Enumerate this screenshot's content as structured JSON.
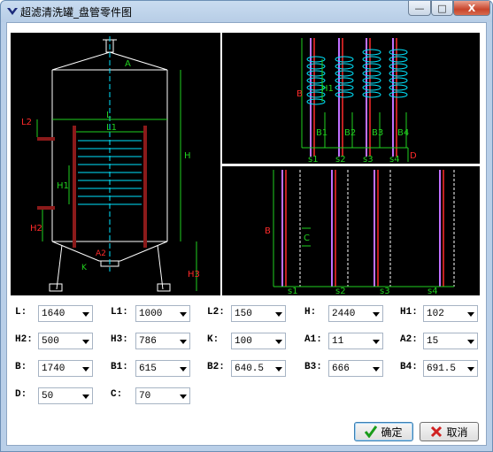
{
  "window": {
    "title": "超滤清洗罐_盘管零件图",
    "controls": {
      "minimize": "—",
      "maximize": "□",
      "close": "X"
    }
  },
  "drawing_left": {
    "dims": [
      "A",
      "L",
      "L1",
      "L2",
      "H",
      "H1",
      "H2",
      "H3",
      "K",
      "A2"
    ]
  },
  "drawing_top_right": {
    "dims": [
      "B",
      "H1",
      "B1",
      "B2",
      "B3",
      "B4",
      "D"
    ],
    "labels": [
      "s1",
      "s2",
      "s3",
      "s4"
    ]
  },
  "drawing_bottom_right": {
    "dims": [
      "B",
      "C"
    ],
    "labels": [
      "s1",
      "s2",
      "s3",
      "s4"
    ]
  },
  "fields": [
    {
      "label": "L:",
      "value": "1640"
    },
    {
      "label": "L1:",
      "value": "1000"
    },
    {
      "label": "L2:",
      "value": "150"
    },
    {
      "label": "H:",
      "value": "2440"
    },
    {
      "label": "H1:",
      "value": "102"
    },
    {
      "label": "H2:",
      "value": "500"
    },
    {
      "label": "H3:",
      "value": "786"
    },
    {
      "label": "K:",
      "value": "100"
    },
    {
      "label": "A1:",
      "value": "11"
    },
    {
      "label": "A2:",
      "value": "15"
    },
    {
      "label": "B:",
      "value": "1740"
    },
    {
      "label": "B1:",
      "value": "615"
    },
    {
      "label": "B2:",
      "value": "640.5"
    },
    {
      "label": "B3:",
      "value": "666"
    },
    {
      "label": "B4:",
      "value": "691.5"
    },
    {
      "label": "D:",
      "value": "50"
    },
    {
      "label": "C:",
      "value": "70"
    }
  ],
  "buttons": {
    "ok": "确定",
    "cancel": "取消"
  },
  "colors": {
    "drawing_bg": "#000000",
    "cyan": "#00e5ff",
    "green": "#21d11f",
    "red": "#ff2a2a",
    "white": "#ffffff",
    "purple": "#c070ff"
  }
}
